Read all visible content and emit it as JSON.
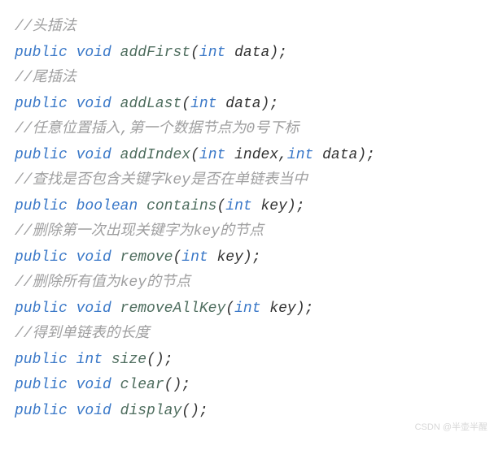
{
  "lines": {
    "c1": "//头插法",
    "kw_public": "public",
    "kw_void": "void",
    "kw_int": "int",
    "kw_boolean": "boolean",
    "m_addFirst": "addFirst",
    "m_addLast": "addLast",
    "m_addIndex": "addIndex",
    "m_contains": "contains",
    "m_remove": "remove",
    "m_removeAllKey": "removeAllKey",
    "m_size": "size",
    "m_clear": "clear",
    "m_display": "display",
    "p_data": " data",
    "p_index": " index",
    "p_key": " key",
    "c2": "//尾插法",
    "c3": "//任意位置插入,第一个数据节点为0号下标",
    "c4": "//查找是否包含关键字key是否在单链表当中",
    "c5": "//删除第一次出现关键字为key的节点",
    "c6": "//删除所有值为key的节点",
    "c7": "//得到单链表的长度",
    "lp": "(",
    "rp": ")",
    "semi": ";",
    "comma": ",",
    "sp": " "
  },
  "watermark": "CSDN @半壶半醒"
}
